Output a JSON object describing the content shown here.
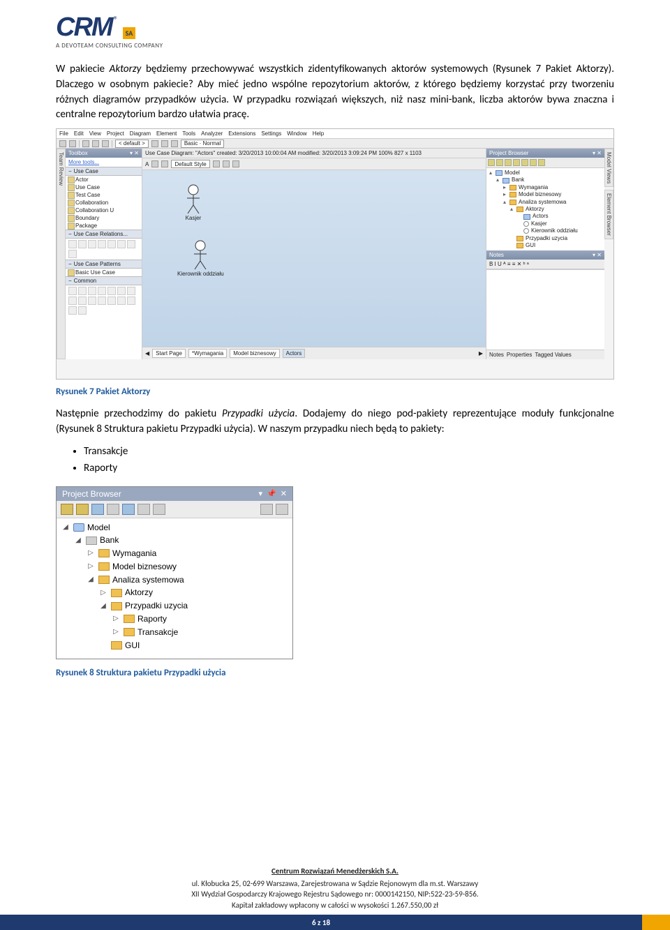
{
  "logo": {
    "text": "CRM",
    "reg": "®",
    "sa": "SA",
    "tag": "A DEVOTEAM CONSULTING COMPANY"
  },
  "para1_prefix": "W pakiecie ",
  "para1_em1": "Aktorzy",
  "para1_mid1": " będziemy przechowywać wszystkich zidentyfikowanych aktorów systemowych (Rysunek 7 Pakiet Aktorzy). Dlaczego w osobnym pakiecie? Aby mieć jedno wspólne repozytorium aktorów, z którego będziemy korzystać przy tworzeniu różnych diagramów przypadków użycia. W przypadku rozwiązań większych, niż nasz mini-bank, liczba aktorów bywa znaczna i centralne repozytorium bardzo ułatwia pracę.",
  "shot1": {
    "menu": [
      "File",
      "Edit",
      "View",
      "Project",
      "Diagram",
      "Element",
      "Tools",
      "Analyzer",
      "Extensions",
      "Settings",
      "Window",
      "Help"
    ],
    "combo_default": "< default >",
    "combo_basic": "Basic · Normal",
    "canvas_title": "Use Case Diagram: \"Actors\"  created: 3/20/2013 10:00:04 AM  modified: 3/20/2013 3:09:24 PM  100%  827 x 1103",
    "default_style": "Default Style",
    "toolbox_title": "Toolbox",
    "more_tools": "More tools...",
    "sections": {
      "usecase": "Use Case",
      "usecase_items": [
        "Actor",
        "Use Case",
        "Test Case",
        "Collaboration",
        "Collaboration U",
        "Boundary",
        "Package"
      ],
      "relations": "Use Case Relations...",
      "patterns": "Use Case Patterns",
      "patterns_items": [
        "Basic Use Case"
      ],
      "common": "Common"
    },
    "actors": {
      "kasjer": "Kasjer",
      "kierownik": "Kierownik oddziału"
    },
    "tabs": [
      "Start Page",
      "*Wymagania",
      "Model biznesowy",
      "Actors"
    ],
    "right_vtab1": "Model Views",
    "right_vtab2": "Element Browser",
    "left_vtab": "Team Review",
    "browser_title": "Project Browser",
    "tree": {
      "model": "Model",
      "bank": "Bank",
      "wym": "Wymagania",
      "mb": "Model biznesowy",
      "as": "Analiza systemowa",
      "akt": "Aktorzy",
      "actors_diag": "Actors",
      "kasjer": "Kasjer",
      "kier": "Kierownik oddziału",
      "pu": "Przypadki uzycia",
      "gui": "GUI"
    },
    "notes_title": "Notes",
    "notes_toolbar": "B  I  U  ᴬ  ≡  ≡  ✕  ᵇ ᵃ",
    "bottom_tabs": [
      "Notes",
      "Properties",
      "Tagged Values"
    ]
  },
  "caption1": "Rysunek 7 Pakiet Aktorzy",
  "para2_prefix": "Następnie przechodzimy do pakietu ",
  "para2_em1": "Przypadki użycia",
  "para2_rest": ". Dodajemy do niego pod-pakiety reprezentujące moduły funkcjonalne (Rysunek 8 Struktura pakietu Przypadki użycia). W naszym przypadku niech będą to pakiety:",
  "bullets": [
    "Transakcje",
    "Raporty"
  ],
  "shot2": {
    "title": "Project Browser",
    "tree": {
      "model": "Model",
      "bank": "Bank",
      "wym": "Wymagania",
      "mb": "Model biznesowy",
      "as": "Analiza systemowa",
      "akt": "Aktorzy",
      "pu": "Przypadki uzycia",
      "rap": "Raporty",
      "tran": "Transakcje",
      "gui": "GUI"
    }
  },
  "caption2": "Rysunek 8 Struktura pakietu Przypadki użycia",
  "footer": {
    "company": "Centrum Rozwiązań Menedżerskich S.A.",
    "line1": "ul. Kłobucka 25, 02-699 Warszawa, Zarejestrowana w Sądzie Rejonowym dla m.st. Warszawy",
    "line2": "XII Wydział Gospodarczy Krajowego Rejestru Sądowego nr: 0000142150, NIP:522-23-59-856.",
    "line3": "Kapitał zakładowy wpłacony w całości w wysokości 1.267.550,00 zł"
  },
  "pagenum": "6 z 18"
}
